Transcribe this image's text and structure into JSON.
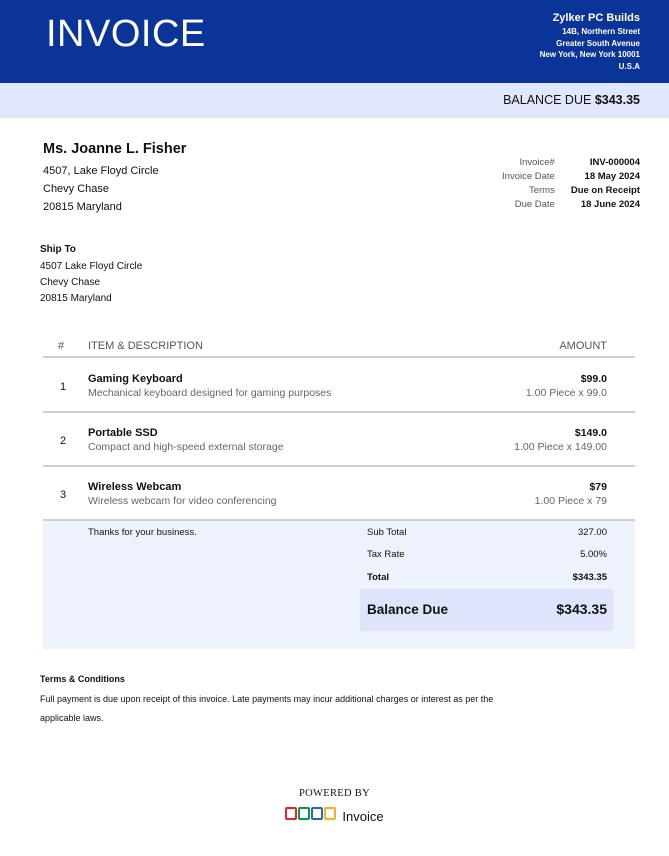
{
  "header": {
    "title": "INVOICE",
    "company": {
      "name": "Zylker PC Builds",
      "address": [
        "14B, Northern Street",
        "Greater South Avenue",
        "New York, New York 10001",
        "U.S.A"
      ]
    }
  },
  "balance_bar": {
    "label": "BALANCE DUE",
    "amount": "$343.35"
  },
  "bill_to": {
    "name": "Ms. Joanne L. Fisher",
    "lines": [
      "4507, Lake Floyd Circle",
      "Chevy Chase",
      "20815 Maryland"
    ]
  },
  "meta": [
    {
      "label": "Invoice#",
      "value": "INV-000004"
    },
    {
      "label": "Invoice Date",
      "value": "18 May 2024"
    },
    {
      "label": "Terms",
      "value": "Due on Receipt"
    },
    {
      "label": "Due Date",
      "value": "18 June 2024"
    }
  ],
  "ship_to": {
    "label": "Ship To",
    "lines": [
      "4507 Lake Floyd Circle",
      "Chevy Chase",
      "20815 Maryland"
    ]
  },
  "items_header": {
    "num": "#",
    "desc": "ITEM & DESCRIPTION",
    "amount": "AMOUNT"
  },
  "items": [
    {
      "num": "1",
      "name": "Gaming Keyboard",
      "description": "Mechanical keyboard designed for gaming purposes",
      "price": "$99.0",
      "qty": "1.00 Piece x 99.0"
    },
    {
      "num": "2",
      "name": "Portable SSD",
      "description": "Compact and high-speed external storage",
      "price": "$149.0",
      "qty": "1.00 Piece x 149.00"
    },
    {
      "num": "3",
      "name": "Wireless Webcam",
      "description": "Wireless webcam for video conferencing",
      "price": "$79",
      "qty": "1.00 Piece x 79"
    }
  ],
  "totals": {
    "thanks": "Thanks for your business.",
    "sub_total_label": "Sub Total",
    "sub_total": "327.00",
    "tax_label": "Tax Rate",
    "tax": "5.00%",
    "total_label": "Total",
    "total": "$343.35",
    "balance_due_label": "Balance Due",
    "balance_due": "$343.35"
  },
  "terms": {
    "label": "Terms & Conditions",
    "text_line1": "Full payment is due upon receipt of this invoice. Late payments may incur additional charges or interest as per the",
    "text_line2": "applicable laws."
  },
  "footer": {
    "powered_by": "POWERED BY",
    "brand": "Invoice",
    "logo_colors": [
      "#e42527",
      "#089949",
      "#226db4",
      "#f9b21d"
    ]
  },
  "colors": {
    "header_bg": "#0b3498",
    "balance_bar_bg": "#e1e7fb",
    "totals_bg": "#eef2fd",
    "balance_due_bg": "#dde4fb"
  }
}
